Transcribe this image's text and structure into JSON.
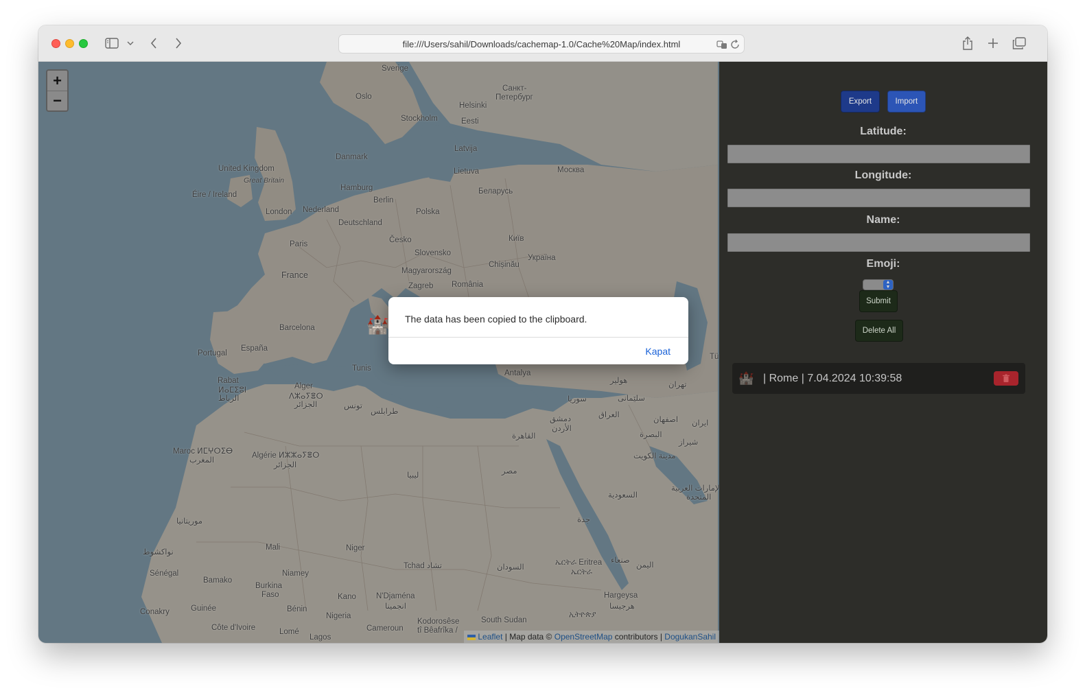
{
  "browser": {
    "url": "file:///Users/sahil/Downloads/cachemap-1.0/Cache%20Map/index.html",
    "icons": [
      "sidebar-icon",
      "chevron-down-icon",
      "back-icon",
      "forward-icon",
      "translate-icon",
      "reload-icon",
      "share-icon",
      "new-tab-icon",
      "tabs-overview-icon"
    ]
  },
  "map": {
    "zoom_in": "+",
    "zoom_out": "−",
    "marker_emoji": "🏰",
    "labels": [
      {
        "text": "Sverige"
      },
      {
        "text": "Oslo"
      },
      {
        "text": "Санкт-"
      },
      {
        "text": "Петербург"
      },
      {
        "text": "Helsinki"
      },
      {
        "text": "Stockholm"
      },
      {
        "text": "Eesti"
      },
      {
        "text": "Latvija"
      },
      {
        "text": "Danmark"
      },
      {
        "text": "Lietuva"
      },
      {
        "text": "Москва"
      },
      {
        "text": "United Kingdom"
      },
      {
        "text": "Great Britain"
      },
      {
        "text": "Éire / Ireland"
      },
      {
        "text": "Hamburg"
      },
      {
        "text": "Berlin"
      },
      {
        "text": "Беларусь"
      },
      {
        "text": "London"
      },
      {
        "text": "Nederland"
      },
      {
        "text": "Polska"
      },
      {
        "text": "Deutschland"
      },
      {
        "text": "Paris"
      },
      {
        "text": "Česko"
      },
      {
        "text": "Київ"
      },
      {
        "text": "Slovensko"
      },
      {
        "text": "Україна"
      },
      {
        "text": "Chișinău"
      },
      {
        "text": "Magyarország"
      },
      {
        "text": "France"
      },
      {
        "text": "Zagreb"
      },
      {
        "text": "România"
      },
      {
        "text": "Barcelona"
      },
      {
        "text": "Portugal"
      },
      {
        "text": "España"
      },
      {
        "text": "Tunis"
      },
      {
        "text": "Antalya"
      },
      {
        "text": "Rabat"
      },
      {
        "text": "ⵍⴰⵎⵉⵓⵏ"
      },
      {
        "text": "الرباط"
      },
      {
        "text": "Alger"
      },
      {
        "text": "ⴷⵣⴰⵢⴻⵔ"
      },
      {
        "text": "الجزائر"
      },
      {
        "text": "تونس"
      },
      {
        "text": "طرابلس"
      },
      {
        "text": "هولير"
      },
      {
        "text": "تهران"
      },
      {
        "text": "سوريا"
      },
      {
        "text": "سلێمانی"
      },
      {
        "text": "دمشق"
      },
      {
        "text": "العراق"
      },
      {
        "text": "الأردن"
      },
      {
        "text": "اصفهان"
      },
      {
        "text": "ایران"
      },
      {
        "text": "البصرة"
      },
      {
        "text": "شیراز"
      },
      {
        "text": "Maroc ⵍⵎⵖⵔⵉⴱ"
      },
      {
        "text": "المغرب"
      },
      {
        "text": "Algérie ⵍⵣⵣⴰⵢⴻⵔ"
      },
      {
        "text": "الجزائر"
      },
      {
        "text": "القاهرة"
      },
      {
        "text": "مدينة الكويت"
      },
      {
        "text": "ليبيا"
      },
      {
        "text": "مصر"
      },
      {
        "text": "الإمارات العربية"
      },
      {
        "text": "المتحدة"
      },
      {
        "text": "السعودية"
      },
      {
        "text": "موريتانيا"
      },
      {
        "text": "جدة"
      },
      {
        "text": "Mali"
      },
      {
        "text": "Niger"
      },
      {
        "text": "نواكشوط"
      },
      {
        "text": "Tchad تشاد"
      },
      {
        "text": "السودان"
      },
      {
        "text": "ኤርትራ Eritrea"
      },
      {
        "text": "ኤርትራ"
      },
      {
        "text": "صنعاء"
      },
      {
        "text": "اليمن"
      },
      {
        "text": "Sénégal"
      },
      {
        "text": "Niamey"
      },
      {
        "text": "Bamako"
      },
      {
        "text": "Burkina"
      },
      {
        "text": "Faso"
      },
      {
        "text": "N'Djaména"
      },
      {
        "text": "انجمينا"
      },
      {
        "text": "Hargeysa"
      },
      {
        "text": "هرجيسا"
      },
      {
        "text": "Kano"
      },
      {
        "text": "Conakry"
      },
      {
        "text": "Guinée"
      },
      {
        "text": "Bénin"
      },
      {
        "text": "Nigeria"
      },
      {
        "text": "Kodorosêse"
      },
      {
        "text": "tî Bêafrîka /"
      },
      {
        "text": "South Sudan"
      },
      {
        "text": "ኢትዮጵያ"
      },
      {
        "text": "Côte d'Ivoire"
      },
      {
        "text": "Lomé"
      },
      {
        "text": "Lagos"
      },
      {
        "text": "Cameroun"
      },
      {
        "text": "Tü"
      }
    ],
    "attribution": {
      "leaflet": "Leaflet",
      "sep1": " | Map data © ",
      "osm": "OpenStreetMap",
      "contrib": " contributors | ",
      "author": "DogukanSahil"
    }
  },
  "alert": {
    "message": "The data has been copied to the clipboard.",
    "button": "Kapat"
  },
  "panel": {
    "export_label": "Export",
    "import_label": "Import",
    "latitude_label": "Latitude:",
    "longitude_label": "Longitude:",
    "name_label": "Name:",
    "emoji_label": "Emoji:",
    "submit_label": "Submit",
    "delete_all_label": "Delete All",
    "entries": [
      {
        "emoji": "🏰",
        "text": "| Rome | 7.04.2024 10:39:58",
        "delete_icon": "trash-icon"
      }
    ]
  },
  "colors": {
    "panel_bg": "#2d2d29",
    "export_btn": "#1e3a8a",
    "import_btn": "#2c55b6",
    "dark_btn": "#1d2a19",
    "delete_btn": "#a8242c",
    "alert_link": "#1a62d8"
  }
}
